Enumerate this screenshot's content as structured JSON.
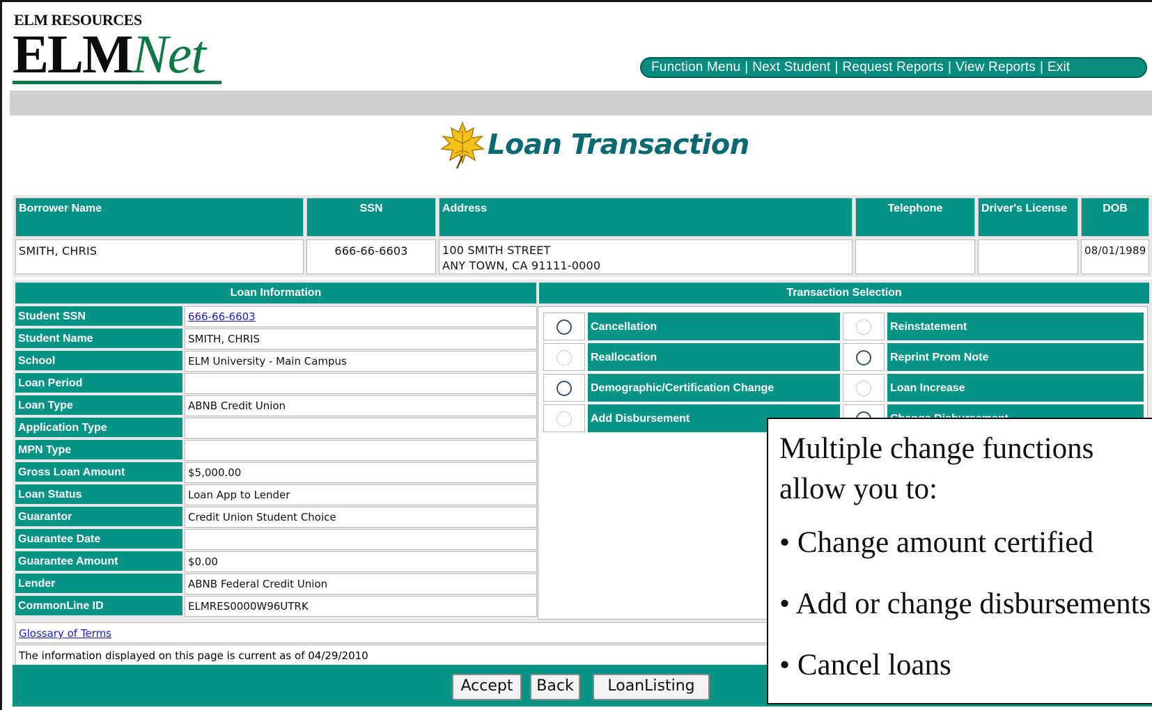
{
  "logo": {
    "small": "ELM RESOURCES",
    "main": "ELM",
    "accent": "Net"
  },
  "nav": {
    "items": [
      "Function Menu",
      "Next Student",
      "Request Reports",
      "View Reports",
      "Exit"
    ],
    "separator": "|"
  },
  "page_title": "Loan Transaction",
  "borrower": {
    "headers": [
      "Borrower Name",
      "SSN",
      "Address",
      "Telephone",
      "Driver's License",
      "DOB"
    ],
    "name": "SMITH, CHRIS",
    "ssn": "666-66-6603",
    "address_line1": "100 SMITH STREET",
    "address_line2": "ANY TOWN, CA 91111-0000",
    "telephone": "",
    "drivers_license": "",
    "dob": "08/01/1989"
  },
  "loan_info": {
    "heading": "Loan Information",
    "rows": [
      {
        "label": "Student SSN",
        "value": "666-66-6603"
      },
      {
        "label": "Student Name",
        "value": "SMITH, CHRIS"
      },
      {
        "label": "School",
        "value": "ELM University - Main Campus"
      },
      {
        "label": "Loan Period",
        "value": ""
      },
      {
        "label": "Loan Type",
        "value": "ABNB Credit Union"
      },
      {
        "label": "Application Type",
        "value": ""
      },
      {
        "label": "MPN Type",
        "value": ""
      },
      {
        "label": "Gross Loan Amount",
        "value": "$5,000.00"
      },
      {
        "label": "Loan Status",
        "value": "Loan App to Lender"
      },
      {
        "label": "Guarantor",
        "value": "Credit Union Student Choice"
      },
      {
        "label": "Guarantee Date",
        "value": ""
      },
      {
        "label": "Guarantee Amount",
        "value": "$0.00"
      },
      {
        "label": "Lender",
        "value": "ABNB Federal Credit Union"
      },
      {
        "label": "CommonLine ID",
        "value": "ELMRES0000W96UTRK"
      }
    ]
  },
  "transaction": {
    "heading": "Transaction Selection",
    "options_left": [
      "Cancellation",
      "Reallocation",
      "Demographic/Certification Change",
      "Add Disbursement"
    ],
    "options_right": [
      "Reinstatement",
      "Reprint Prom Note",
      "Loan Increase",
      "Change Disbursement"
    ]
  },
  "glossary_link": "Glossary of Terms",
  "info_note": "The information displayed on this page is current as of 04/29/2010",
  "buttons": {
    "accept": "Accept",
    "back": "Back",
    "loan_listing": "LoanListing"
  },
  "callout": {
    "line1": "Multiple change functions",
    "line2": "allow you to:",
    "bullets": [
      "Change amount certified",
      "Add or change disbursements",
      "Cancel loans"
    ]
  },
  "colors": {
    "teal": "#079487",
    "logo_green": "#0d7a45",
    "title_teal": "#0a6a74",
    "link_blue": "#1a1ad6"
  }
}
